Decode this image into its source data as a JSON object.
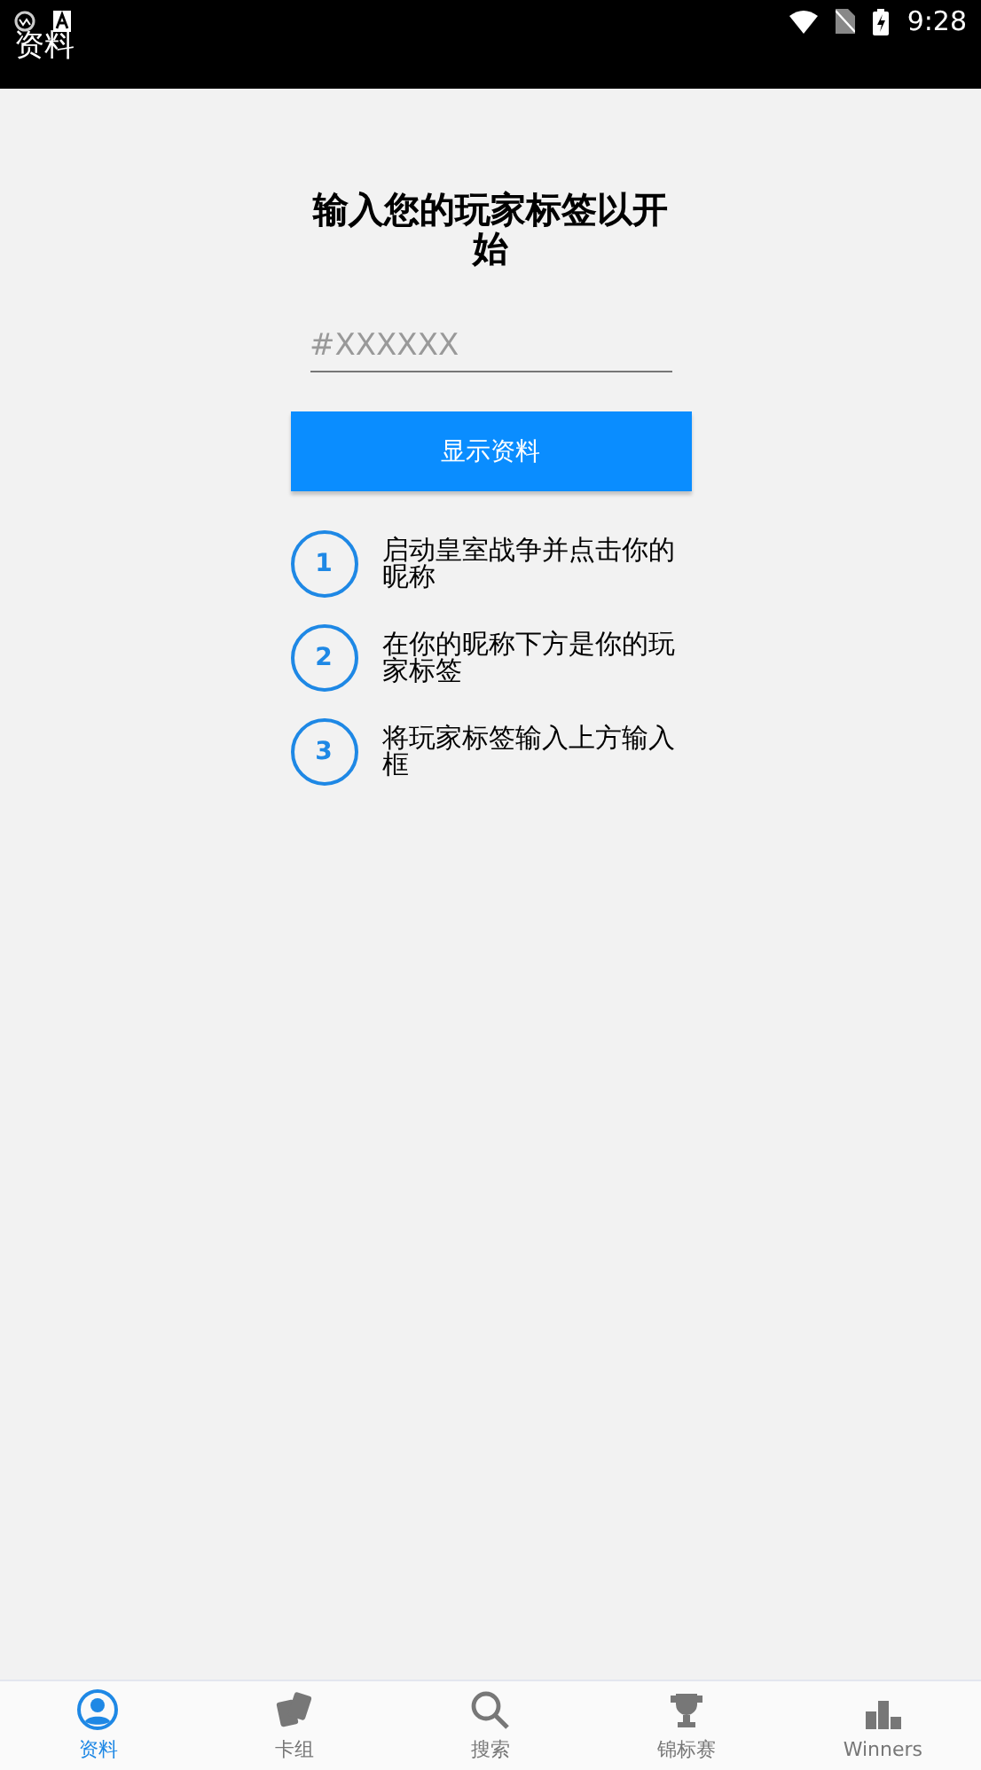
{
  "status_bar": {
    "time": "9:28"
  },
  "app_bar": {
    "title": "资料"
  },
  "heading": "输入您的玩家标签以开始",
  "tag_field": {
    "placeholder": "#XXXXXX"
  },
  "submit_button": "显示资料",
  "steps": [
    {
      "number": "1",
      "text": "启动皇室战争并点击你的昵称"
    },
    {
      "number": "2",
      "text": "在你的昵称下方是你的玩家标签"
    },
    {
      "number": "3",
      "text": "将玩家标签输入上方输入框"
    }
  ],
  "tabs": [
    {
      "label": "资料",
      "kind": "profile",
      "selected": true
    },
    {
      "label": "卡组",
      "kind": "cards",
      "selected": false
    },
    {
      "label": "搜索",
      "kind": "search",
      "selected": false
    },
    {
      "label": "锦标赛",
      "kind": "trophy",
      "selected": false
    },
    {
      "label": "Winners",
      "kind": "winners",
      "selected": false
    }
  ]
}
